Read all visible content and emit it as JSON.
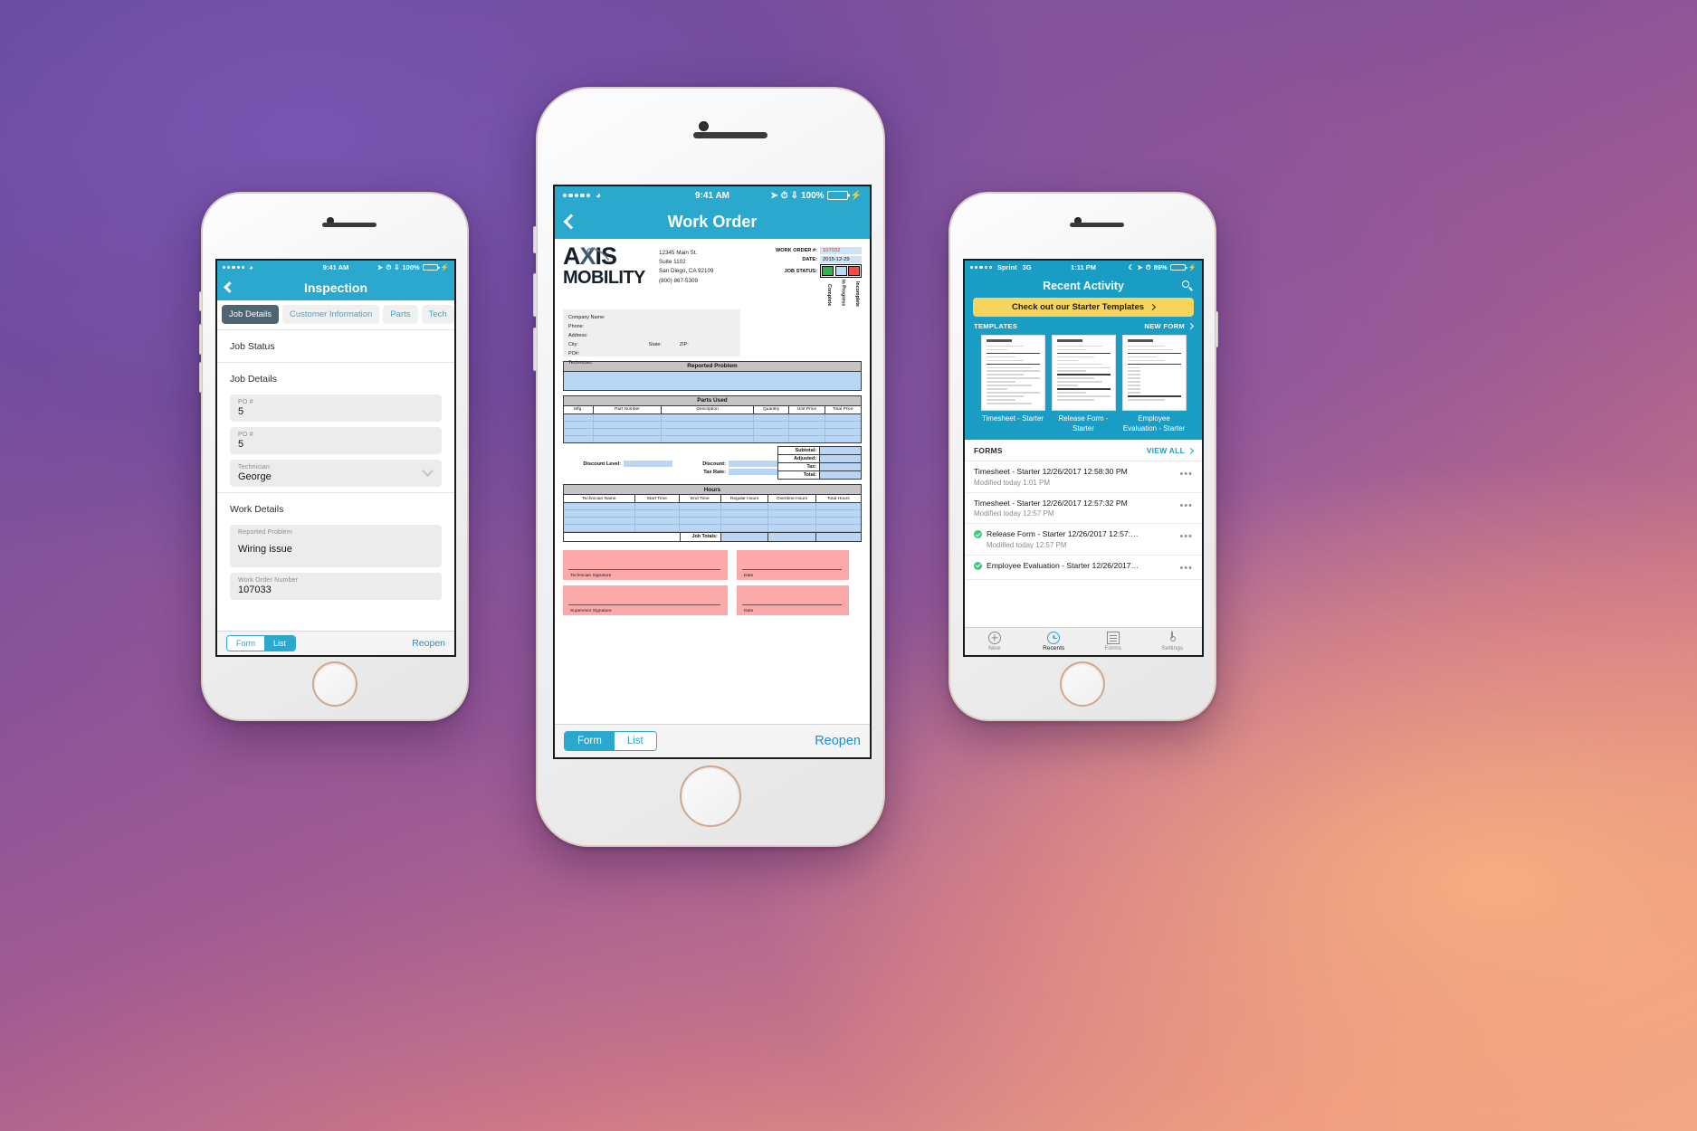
{
  "left_phone": {
    "status_bar": {
      "time": "9:41 AM",
      "battery_pct": "100%",
      "signal_dots": 5
    },
    "nav": {
      "title": "Inspection",
      "back_icon": "chevron-left-icon"
    },
    "tabs": [
      {
        "label": "Job Details",
        "active": true
      },
      {
        "label": "Customer Information",
        "active": false
      },
      {
        "label": "Parts",
        "active": false
      },
      {
        "label": "Tech",
        "active": false
      }
    ],
    "sections": [
      {
        "heading": "Job Status"
      },
      {
        "heading": "Job Details"
      },
      {
        "heading": "Work Details"
      }
    ],
    "fields": [
      {
        "label": "PO #",
        "value": "5",
        "type": "text"
      },
      {
        "label": "PO #",
        "value": "5",
        "type": "text"
      },
      {
        "label": "Technician",
        "value": "George",
        "type": "select"
      },
      {
        "label": "Reported Problem",
        "value": "Wiring issue",
        "type": "textarea"
      },
      {
        "label": "Work Order Number",
        "value": "107033",
        "type": "text"
      }
    ],
    "bottom_bar": {
      "segment": [
        {
          "label": "Form",
          "selected": false
        },
        {
          "label": "List",
          "selected": true
        }
      ],
      "action": "Reopen"
    }
  },
  "center_phone": {
    "status_bar": {
      "time": "9:41 AM",
      "battery_pct": "100%",
      "signal_dots": 5
    },
    "nav": {
      "title": "Work Order",
      "back_icon": "chevron-left-icon"
    },
    "document": {
      "logo": {
        "line1_a": "A",
        "line1_x": "X",
        "line1_b": "IS",
        "line2": "MOBILITY"
      },
      "address": [
        "12345 Main St.",
        "Suite 1102",
        "San Diego, CA 92109",
        "(800) 867-5309"
      ],
      "meta": [
        {
          "label": "WORK ORDER #:",
          "value": "107032",
          "highlight": "red"
        },
        {
          "label": "DATE:",
          "value": "2015-12-29",
          "highlight": "none"
        }
      ],
      "job_status": {
        "label": "JOB STATUS:",
        "options": [
          {
            "name": "Complete",
            "color": "#2fb34a"
          },
          {
            "name": "In Progress",
            "color": "#bdd9f7"
          },
          {
            "name": "Incomplete",
            "color": "#f84a42"
          }
        ]
      },
      "customer_block": [
        "Company Name:",
        "Phone:",
        "Address:",
        "City:",
        "State:",
        "ZIP:",
        "PO#:",
        "Technician:"
      ],
      "reported_problem": {
        "title": "Reported Problem"
      },
      "parts_used": {
        "title": "Parts Used",
        "columns": [
          "Mfg.",
          "Part Number",
          "Description",
          "Quantity",
          "Unit Price",
          "Total Price"
        ],
        "row_count": 4
      },
      "discounts": [
        {
          "label": "Discount Level:"
        },
        {
          "label": "Discount:"
        },
        {
          "label": "Tax Rate:"
        }
      ],
      "totals": [
        "Subtotal:",
        "Adjusted:",
        "Tax:",
        "Total:"
      ],
      "hours": {
        "title": "Hours",
        "columns": [
          "Technician Name",
          "Start Time",
          "End Time",
          "Regular Hours",
          "Overtime Hours",
          "Total Hours"
        ],
        "row_count": 4,
        "job_totals_label": "Job Totals:"
      },
      "signatures": [
        {
          "label": "Technician Signature",
          "size": "wide"
        },
        {
          "label": "Date",
          "size": "narrow"
        },
        {
          "label": "Supervisor Signature",
          "size": "wide"
        },
        {
          "label": "Date",
          "size": "narrow"
        }
      ]
    },
    "bottom_bar": {
      "segment": [
        {
          "label": "Form",
          "selected": true
        },
        {
          "label": "List",
          "selected": false
        }
      ],
      "action": "Reopen"
    }
  },
  "right_phone": {
    "status_bar": {
      "carrier": "Sprint",
      "network": "3G",
      "time": "1:11 PM",
      "battery_pct": "89%",
      "signal_dots": 5
    },
    "nav": {
      "title": "Recent Activity",
      "search_icon": "search-icon"
    },
    "promo_banner": {
      "label": "Check out our Starter Templates",
      "chevron": "chevron-right-icon"
    },
    "templates_section": {
      "heading": "TEMPLATES",
      "action": "NEW FORM",
      "items": [
        {
          "name": "Timesheet - Starter"
        },
        {
          "name": "Release Form - Starter"
        },
        {
          "name": "Employee Evaluation - Starter"
        }
      ]
    },
    "forms_section": {
      "heading": "FORMS",
      "action": "VIEW ALL",
      "rows": [
        {
          "title": "Timesheet - Starter 12/26/2017 12:58:30 PM",
          "subtitle": "Modified today 1:01 PM",
          "completed": false
        },
        {
          "title": "Timesheet - Starter 12/26/2017 12:57:32 PM",
          "subtitle": "Modified today 12:57 PM",
          "completed": false
        },
        {
          "title": "Release Form - Starter 12/26/2017 12:57:…",
          "subtitle": "Modified today 12:57 PM",
          "completed": true
        },
        {
          "title": "Employee Evaluation - Starter 12/26/2017…",
          "subtitle": "",
          "completed": true
        }
      ],
      "overflow_glyph": "•••"
    },
    "tab_bar": [
      {
        "label": "New",
        "icon": "plus-circle-icon",
        "active": false
      },
      {
        "label": "Recents",
        "icon": "clock-icon",
        "active": true
      },
      {
        "label": "Forms",
        "icon": "document-icon",
        "active": false
      },
      {
        "label": "Settings",
        "icon": "gear-icon",
        "active": false
      }
    ]
  },
  "theme": {
    "accent_teal": "#2aa8cd",
    "nav_teal": "#1a9dc4",
    "banner_yellow": "#f7d45e",
    "link_blue": "#1f8ed6",
    "status_green": "#2fb34a",
    "status_blue": "#bdd9f7",
    "status_red": "#f84a42",
    "signature_pink": "#fba9a9",
    "table_blue": "#b9d7f5"
  }
}
